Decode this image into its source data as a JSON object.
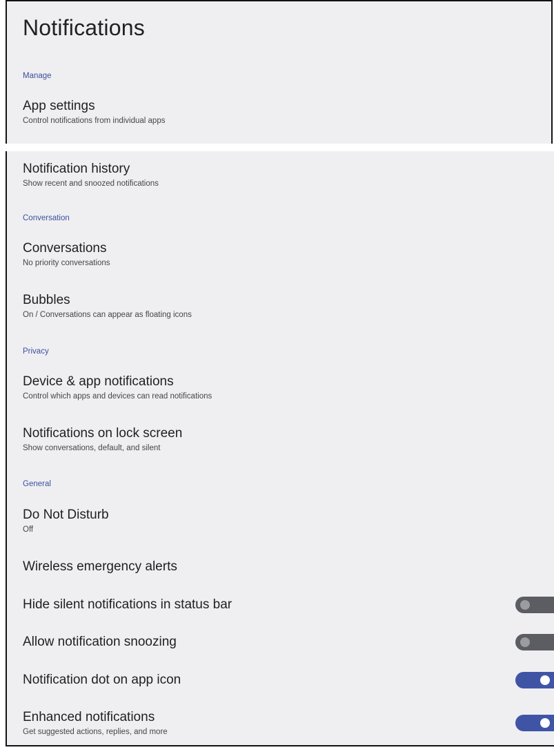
{
  "header": {
    "title": "Notifications"
  },
  "sections": {
    "manage": "Manage",
    "conversation": "Conversation",
    "privacy": "Privacy",
    "general": "General"
  },
  "items": {
    "app_settings": {
      "title": "App settings",
      "subtitle": "Control notifications from individual apps"
    },
    "notification_history": {
      "title": "Notification history",
      "subtitle": "Show recent and snoozed notifications"
    },
    "conversations": {
      "title": "Conversations",
      "subtitle": "No priority conversations"
    },
    "bubbles": {
      "title": "Bubbles",
      "subtitle": "On / Conversations can appear as floating icons"
    },
    "device_app_notifications": {
      "title": "Device & app notifications",
      "subtitle": "Control which apps and devices can read notifications"
    },
    "lock_screen": {
      "title": "Notifications on lock screen",
      "subtitle": "Show conversations, default, and silent"
    },
    "do_not_disturb": {
      "title": "Do Not Disturb",
      "subtitle": "Off"
    },
    "wireless_alerts": {
      "title": "Wireless emergency alerts"
    },
    "hide_silent": {
      "title": "Hide silent notifications in status bar",
      "enabled": false
    },
    "allow_snoozing": {
      "title": "Allow notification snoozing",
      "enabled": false
    },
    "notification_dot": {
      "title": "Notification dot on app icon",
      "enabled": true
    },
    "enhanced": {
      "title": "Enhanced notifications",
      "subtitle": "Get suggested actions, replies, and more",
      "enabled": true
    }
  },
  "colors": {
    "background": "#efeff2",
    "section_header": "#3d4f9c",
    "switch_on": "#4054a6",
    "switch_off": "#5b5d62"
  }
}
